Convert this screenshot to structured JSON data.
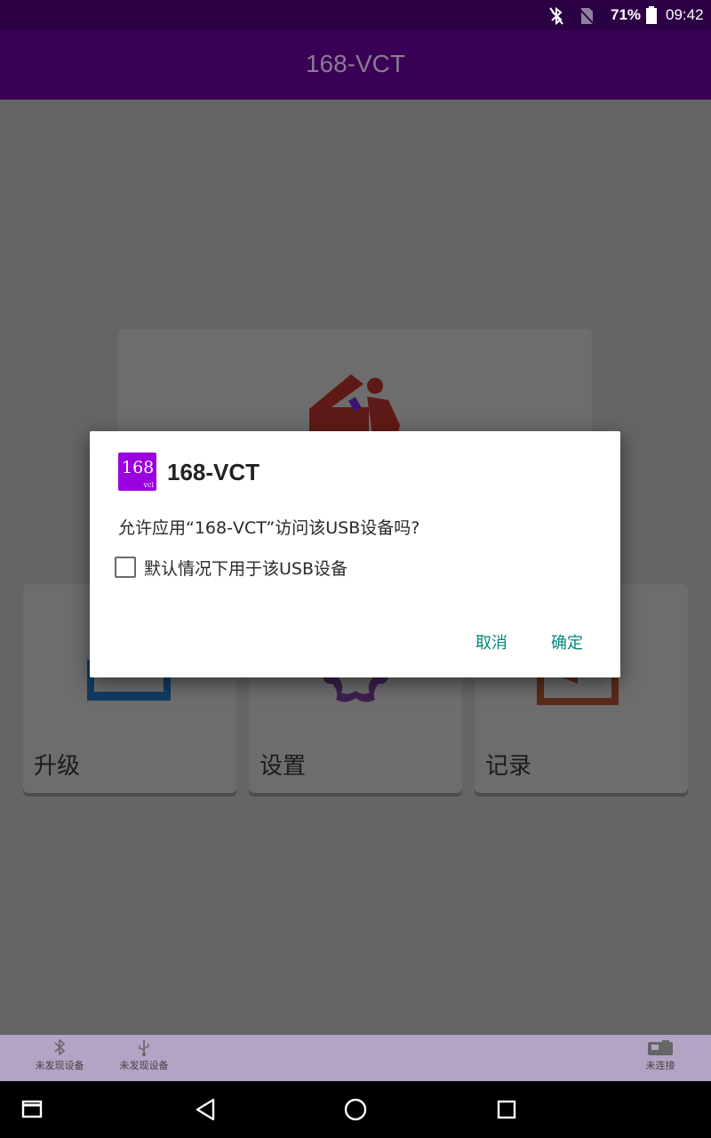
{
  "status_bar": {
    "battery": "71%",
    "time": "09:42"
  },
  "app_bar": {
    "title": "168-VCT"
  },
  "cards": [
    {
      "label": "升级"
    },
    {
      "label": "设置"
    },
    {
      "label": "记录"
    }
  ],
  "dialog": {
    "icon_text": "168",
    "icon_subtext": "vci",
    "title": "168-VCT",
    "message": "允许应用“168-VCT”访问该USB设备吗?",
    "checkbox_label": "默认情况下用于该USB设备",
    "checkbox_checked": false,
    "cancel_label": "取消",
    "ok_label": "确定"
  },
  "bottom_bar": {
    "bluetooth_status": "未发现设备",
    "usb_status": "未发现设备",
    "connection_status": "未连接"
  },
  "colors": {
    "accent": "#00897b",
    "status_bar": "#2c0045",
    "app_bar": "#3a0055",
    "bottom_bar": "#b3a3c5"
  }
}
